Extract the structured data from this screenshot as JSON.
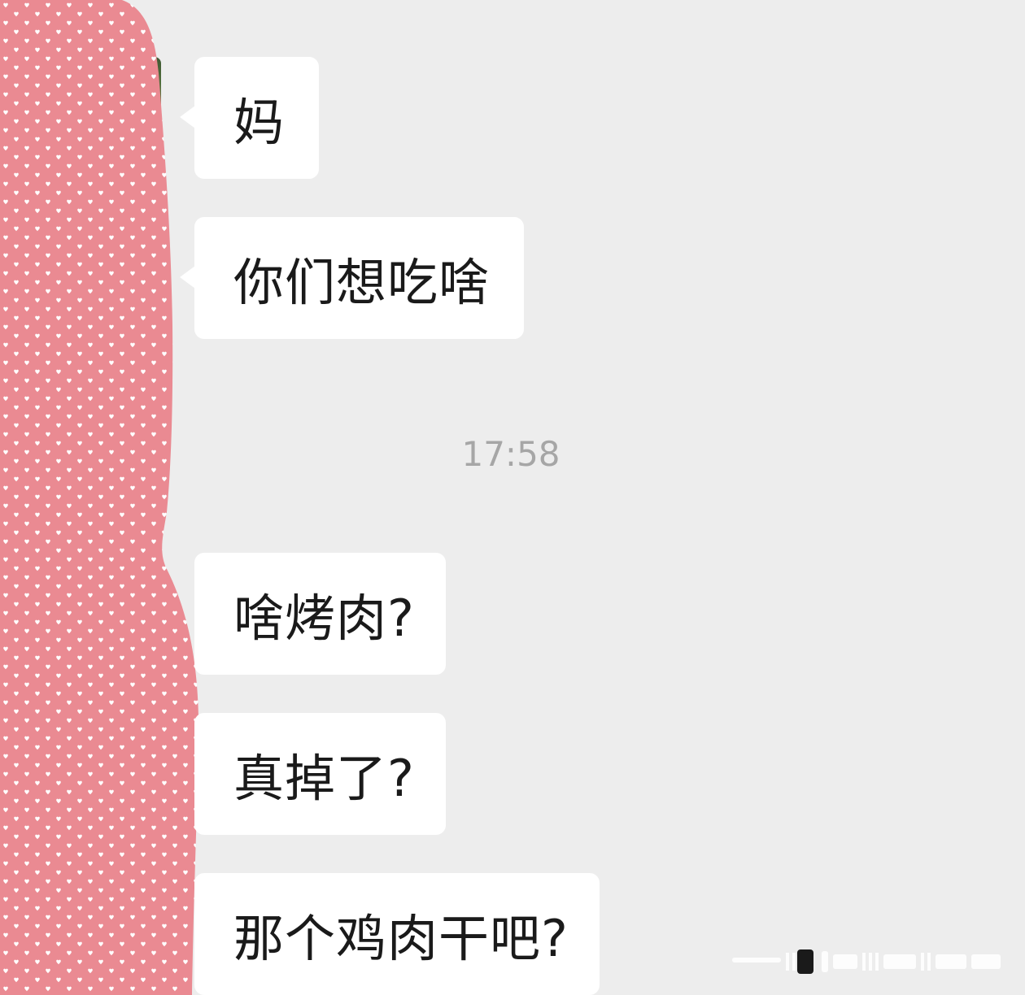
{
  "chat": {
    "timestamp": "17:58",
    "messages": [
      {
        "sender": "other",
        "text": "妈"
      },
      {
        "sender": "other",
        "text": "你们想吃啥"
      },
      {
        "sender": "other",
        "text": "啥烤肉?"
      },
      {
        "sender": "other",
        "text": "真掉了?"
      },
      {
        "sender": "other",
        "text": "那个鸡肉干吧?"
      }
    ]
  },
  "colors": {
    "background": "#ededed",
    "bubble": "#ffffff",
    "text": "#1a1a1a",
    "timestamp": "#a6a6a6",
    "mask_pink": "#ea8a92",
    "mask_heart": "#ffffff"
  },
  "icons": {
    "avatar": "avatar-photo",
    "mask": "heart-pattern-privacy-mask"
  }
}
